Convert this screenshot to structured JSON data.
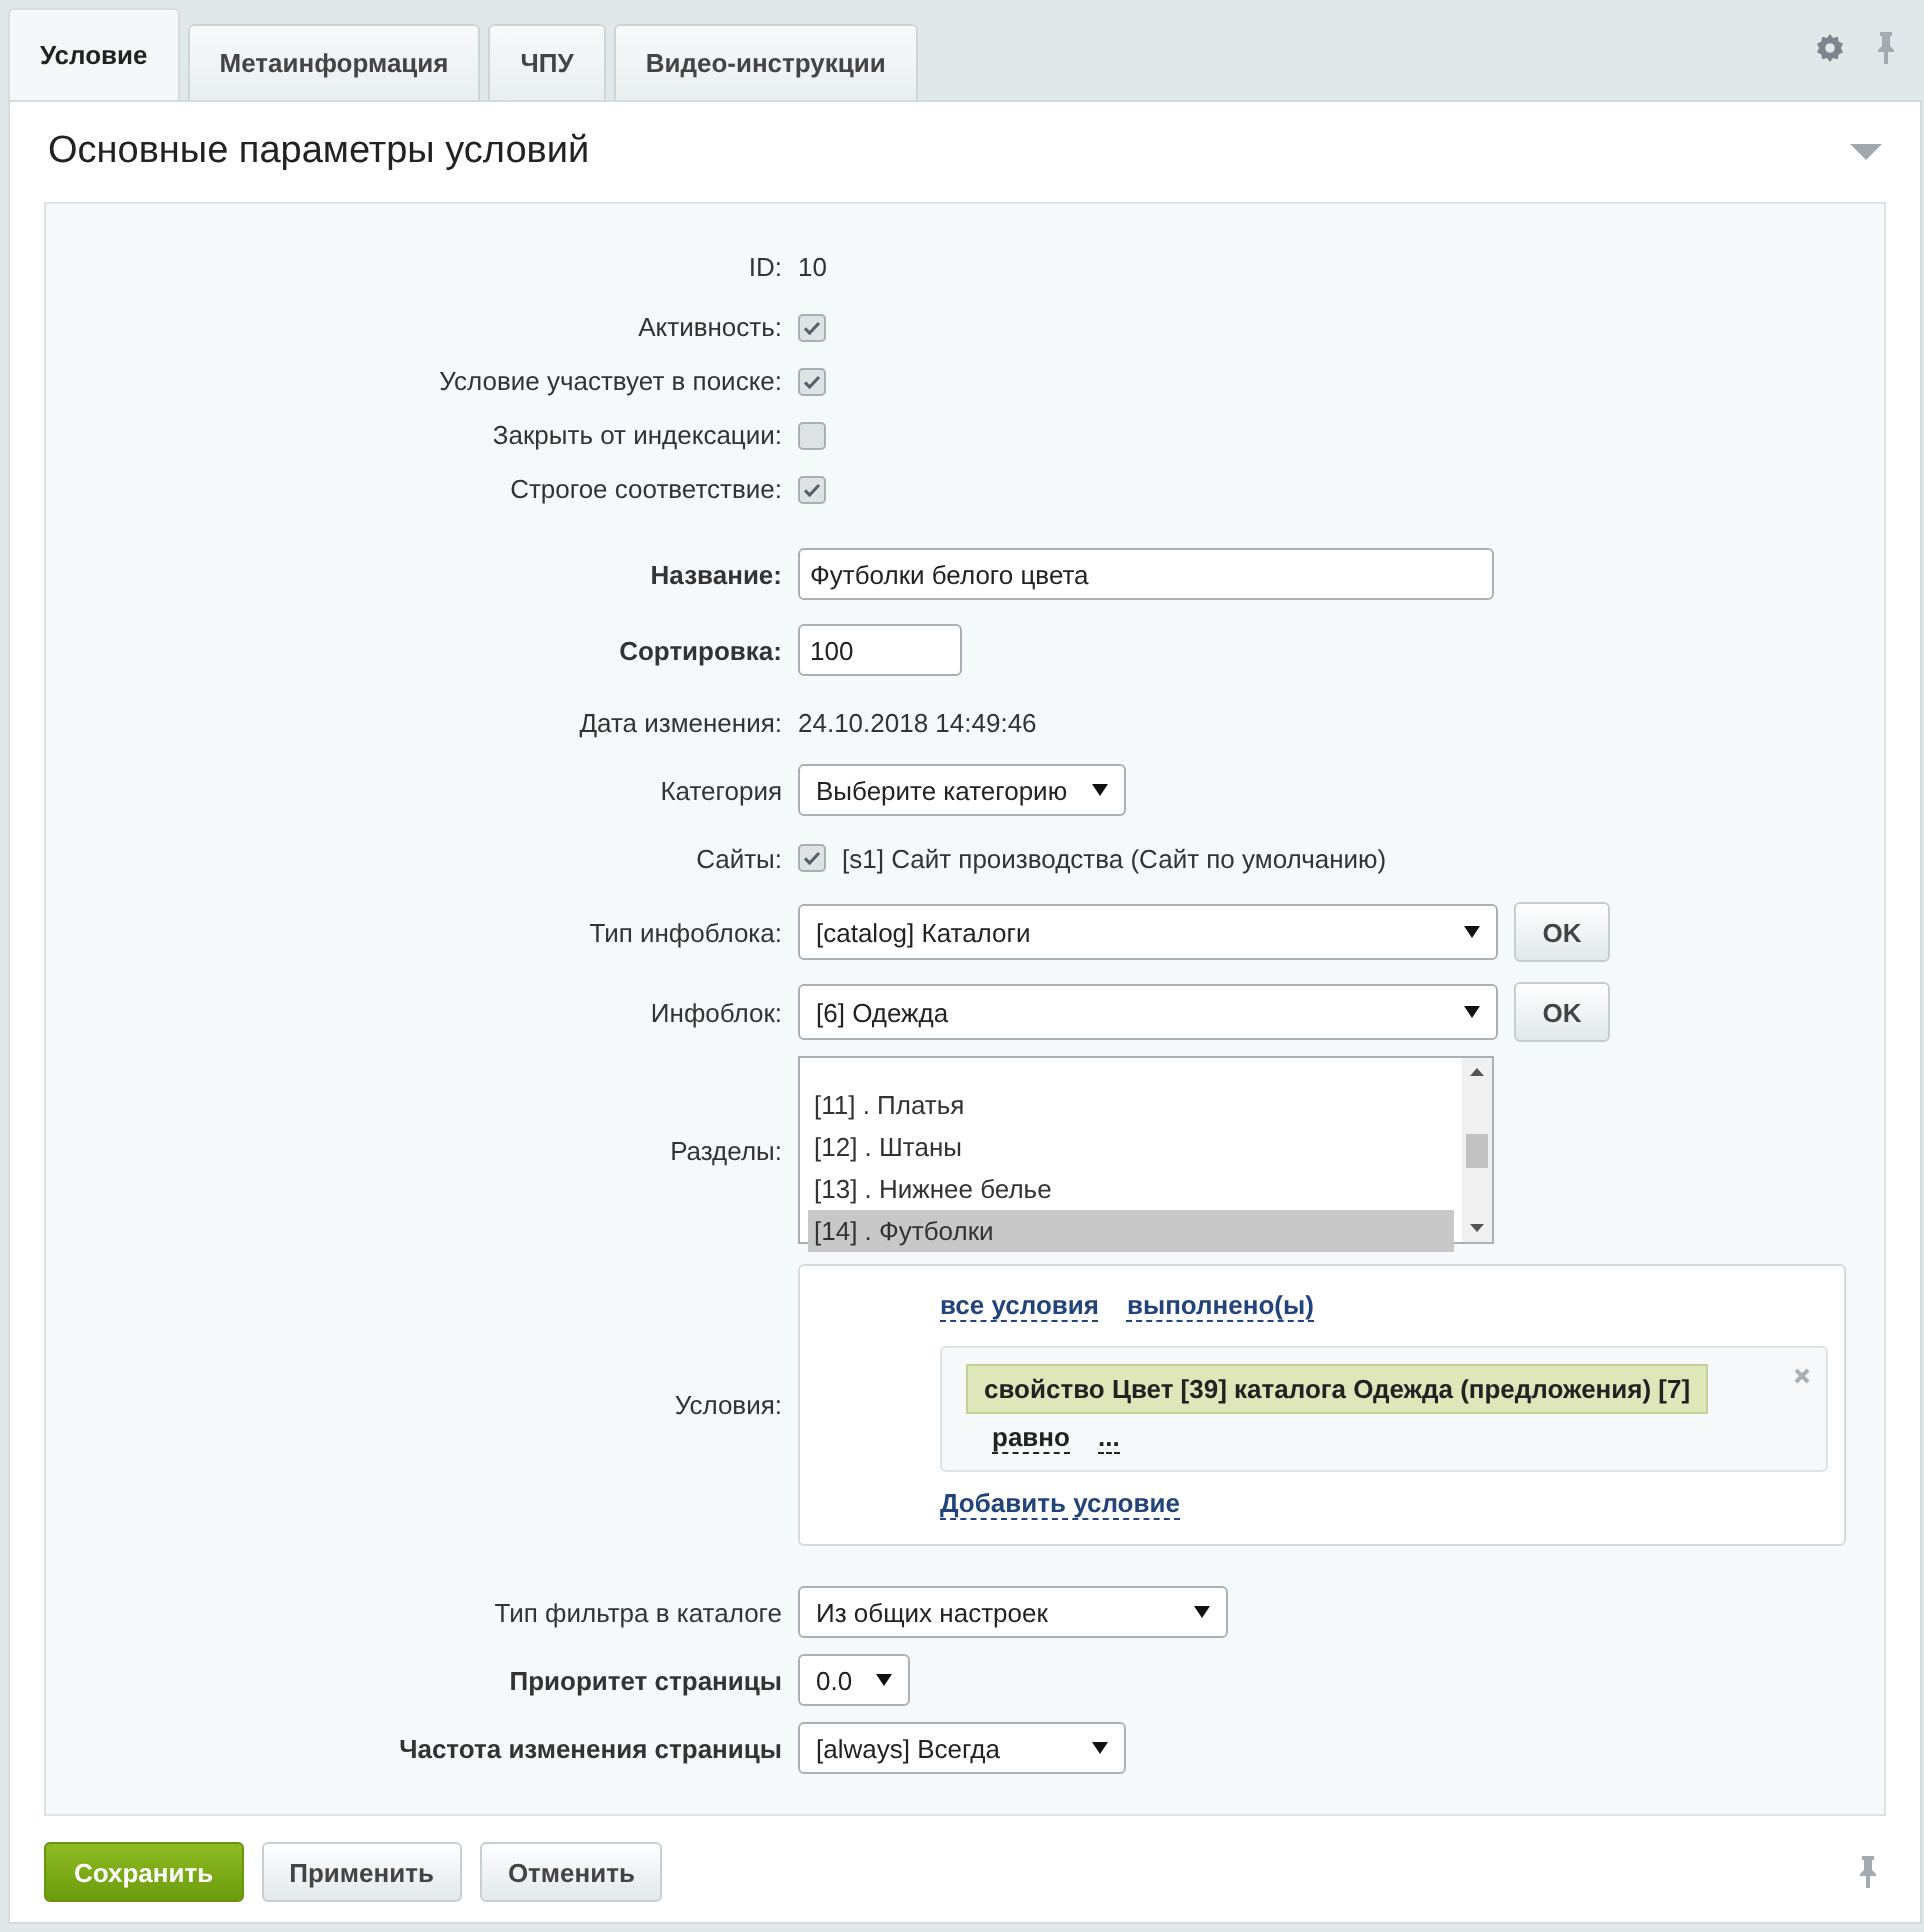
{
  "tabs": [
    {
      "label": "Условие",
      "selected": true
    },
    {
      "label": "Метаинформация",
      "selected": false
    },
    {
      "label": "ЧПУ",
      "selected": false
    },
    {
      "label": "Видео-инструкции",
      "selected": false
    }
  ],
  "section": {
    "title": "Основные параметры условий"
  },
  "fields": [
    {
      "kind": "text",
      "label": "ID:",
      "bold": false,
      "value": "10"
    },
    {
      "kind": "checkbox",
      "label": "Активность:",
      "bold": false,
      "checked": true
    },
    {
      "kind": "checkbox",
      "label": "Условие участвует в поиске:",
      "bold": false,
      "checked": true
    },
    {
      "kind": "checkbox",
      "label": "Закрыть от индексации:",
      "bold": false,
      "checked": false
    },
    {
      "kind": "checkbox",
      "label": "Строгое соответствие:",
      "bold": false,
      "checked": true
    },
    {
      "kind": "input",
      "label": "Название:",
      "bold": true,
      "value": "Футболки белого цвета"
    },
    {
      "kind": "number",
      "label": "Сортировка:",
      "bold": true,
      "value": "100"
    },
    {
      "kind": "text",
      "label": "Дата изменения:",
      "bold": false,
      "value": "24.10.2018 14:49:46"
    },
    {
      "kind": "select",
      "label": "Категория",
      "bold": false,
      "value": "Выберите категорию"
    },
    {
      "kind": "site",
      "label": "Сайты:",
      "bold": false,
      "checked": true,
      "text": "[s1] Сайт производства (Сайт по умолчанию)"
    },
    {
      "kind": "select_ok",
      "label": "Тип инфоблока:",
      "bold": false,
      "value": "[catalog] Каталоги",
      "button": "OK"
    },
    {
      "kind": "select_ok",
      "label": "Инфоблок:",
      "bold": false,
      "value": "[6] Одежда",
      "button": "OK"
    },
    {
      "kind": "listbox",
      "label": "Разделы:",
      "bold": false,
      "options": [
        {
          "label": "[11] . Платья",
          "selected": false
        },
        {
          "label": "[12] . Штаны",
          "selected": false
        },
        {
          "label": "[13] . Нижнее белье",
          "selected": false
        },
        {
          "label": "[14] . Футболки",
          "selected": true
        }
      ]
    },
    {
      "kind": "conditions",
      "label": "Условия:",
      "bold": false,
      "links": [
        "все условия",
        "выполнено(ы)"
      ],
      "condition": {
        "text": "свойство Цвет [39] каталога Одежда (предложения) [7]",
        "operator": "равно",
        "value": "..."
      },
      "add": "Добавить условие"
    },
    {
      "kind": "select_wide",
      "label": "Тип фильтра в каталоге",
      "bold": false,
      "value": "Из общих настроек"
    },
    {
      "kind": "select",
      "label": "Приоритет страницы",
      "bold": true,
      "value": "0.0"
    },
    {
      "kind": "select_wide",
      "label": "Частота изменения страницы",
      "bold": true,
      "value": "[always] Всегда"
    }
  ],
  "buttons": [
    {
      "label": "Сохранить",
      "kind": "primary"
    },
    {
      "label": "Применить",
      "kind": "normal"
    },
    {
      "label": "Отменить",
      "kind": "normal"
    }
  ]
}
